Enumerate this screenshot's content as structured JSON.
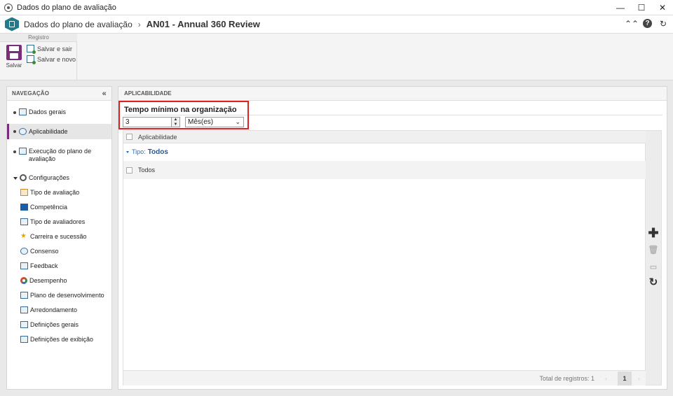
{
  "window": {
    "title": "Dados do plano de avaliação",
    "controls": {
      "minimize": "—",
      "maximize": "☐",
      "close": "✕"
    }
  },
  "header": {
    "breadcrumb": "Dados do plano de avaliação",
    "separator": "›",
    "record_title": "AN01 - Annual 360 Review",
    "icons": [
      "collapse-up-icon",
      "help-icon",
      "refresh-icon"
    ],
    "help_glyph": "?",
    "collapse_glyph": "⌃⌃",
    "refresh_glyph": "↻"
  },
  "ribbon": {
    "group_label": "Registro",
    "save_label": "Salvar",
    "save_exit_label": "Salvar e sair",
    "save_new_label": "Salvar e novo"
  },
  "nav": {
    "heading": "NAVEGAÇÃO",
    "collapse_glyph": "«",
    "items": [
      {
        "label": "Dados gerais",
        "icon": "general-data-icon"
      },
      {
        "label": "Aplicabilidade",
        "icon": "applicability-icon",
        "active": true
      },
      {
        "label": "Execução do plano de avaliação",
        "icon": "execution-icon"
      }
    ],
    "config": {
      "label": "Configurações",
      "children": [
        {
          "label": "Tipo de avaliação",
          "icon": "evaluation-type-icon"
        },
        {
          "label": "Competência",
          "icon": "competence-icon"
        },
        {
          "label": "Tipo de avaliadores",
          "icon": "evaluator-type-icon"
        },
        {
          "label": "Carreira e sucessão",
          "icon": "career-star-icon"
        },
        {
          "label": "Consenso",
          "icon": "consensus-icon"
        },
        {
          "label": "Feedback",
          "icon": "feedback-icon"
        },
        {
          "label": "Desempenho",
          "icon": "performance-icon"
        },
        {
          "label": "Plano de desenvolvimento",
          "icon": "development-plan-icon"
        },
        {
          "label": "Arredondamento",
          "icon": "rounding-icon"
        },
        {
          "label": "Definições gerais",
          "icon": "general-settings-icon"
        },
        {
          "label": "Definições de exibição",
          "icon": "display-settings-icon"
        }
      ]
    }
  },
  "main": {
    "section_heading": "APLICABILIDADE",
    "min_time": {
      "label": "Tempo mínimo na organização",
      "value": "3",
      "unit_selected": "Mês(es)"
    },
    "grid": {
      "column_header": "Aplicabilidade",
      "group_label": "Tipo:",
      "group_value": "Todos",
      "rows": [
        {
          "label": "Todos"
        }
      ],
      "footer_total": "Total de registros: 1",
      "current_page": "1",
      "prev_glyph": "‹",
      "next_glyph": "›"
    },
    "tools": {
      "add_glyph": "✚",
      "delete_glyph": "🗑",
      "view_glyph": "▭",
      "refresh_glyph": "↻"
    }
  }
}
